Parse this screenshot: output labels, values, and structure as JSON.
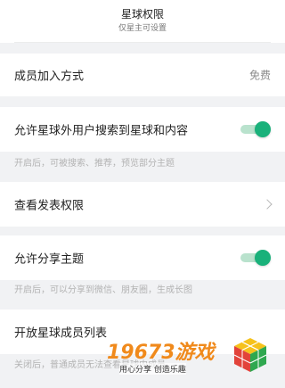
{
  "header": {
    "title": "星球权限",
    "subtitle": "仅星主可设置"
  },
  "join_method": {
    "label": "成员加入方式",
    "value": "免费"
  },
  "allow_search": {
    "label": "允许星球外用户搜索到星球和内容",
    "enabled": true,
    "hint": "开启后，可被搜索、推荐，预览部分主题"
  },
  "post_permission": {
    "label": "查看发表权限"
  },
  "allow_share": {
    "label": "允许分享主题",
    "enabled": true,
    "hint": "开启后，可以分享到微信、朋友圈，生成长图"
  },
  "open_member_list": {
    "label": "开放星球成员列表",
    "hint": "关闭后，普通成员无法查看星球内成员"
  },
  "watermark": {
    "title": "19673游戏",
    "slogan": "用心分享 创造乐趣"
  },
  "colors": {
    "toggle_on": "#19b17a",
    "background": "#f1f2f4",
    "watermark": "#f08a1c"
  }
}
